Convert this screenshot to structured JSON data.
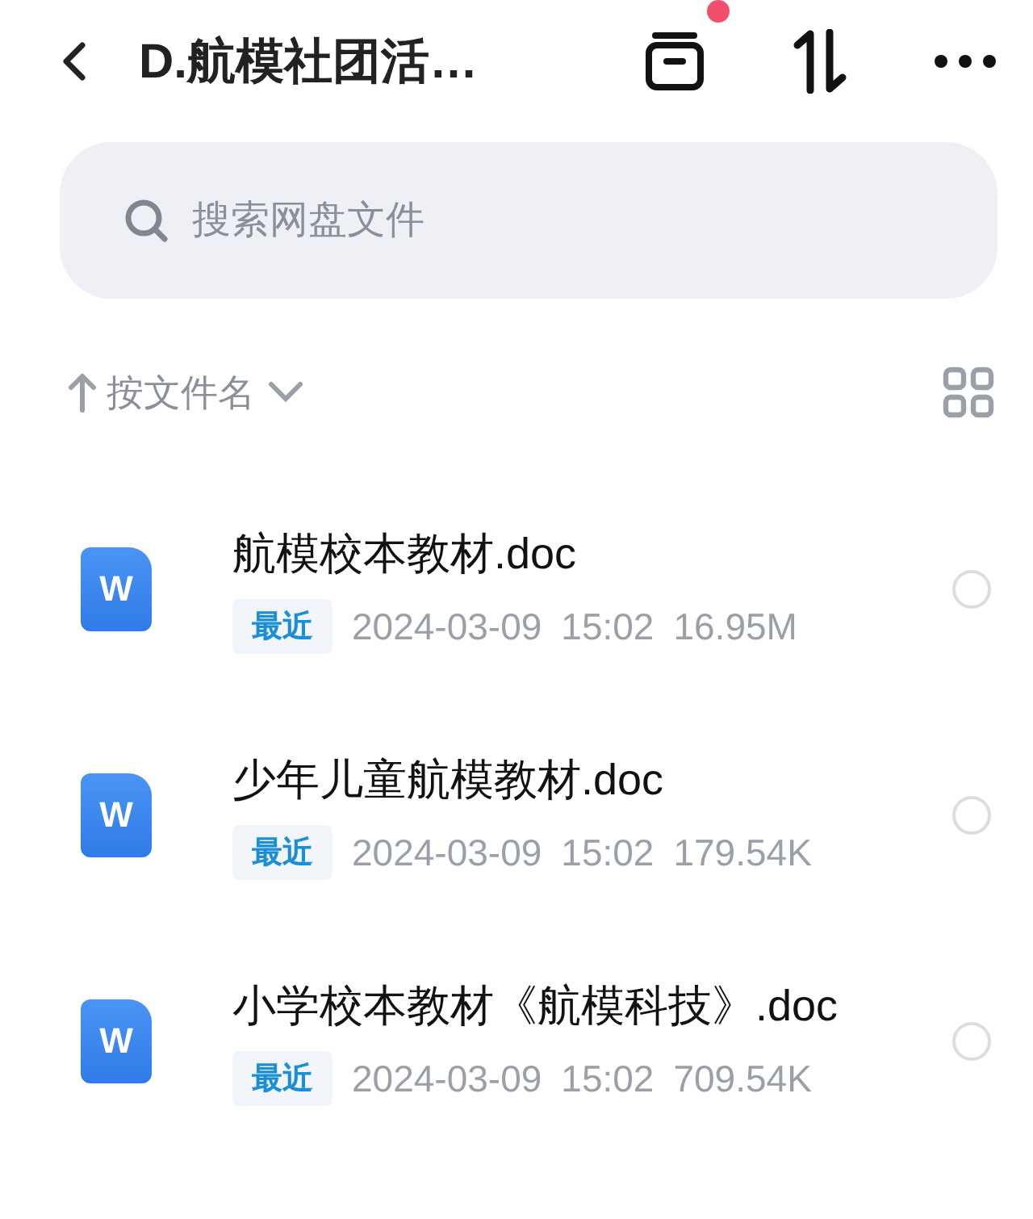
{
  "header": {
    "title": "D.航模社团活…",
    "badge": true
  },
  "search": {
    "placeholder": "搜索网盘文件"
  },
  "sort": {
    "label": "按文件名"
  },
  "files": [
    {
      "name": "航模校本教材.doc",
      "icon_letter": "W",
      "tag": "最近",
      "date": "2024-03-09",
      "time": "15:02",
      "size": "16.95M",
      "selected": false
    },
    {
      "name": "少年儿童航模教材.doc",
      "icon_letter": "W",
      "tag": "最近",
      "date": "2024-03-09",
      "time": "15:02",
      "size": "179.54K",
      "selected": false
    },
    {
      "name": "小学校本教材《航模科技》.doc",
      "icon_letter": "W",
      "tag": "最近",
      "date": "2024-03-09",
      "time": "15:02",
      "size": "709.54K",
      "selected": false
    }
  ]
}
